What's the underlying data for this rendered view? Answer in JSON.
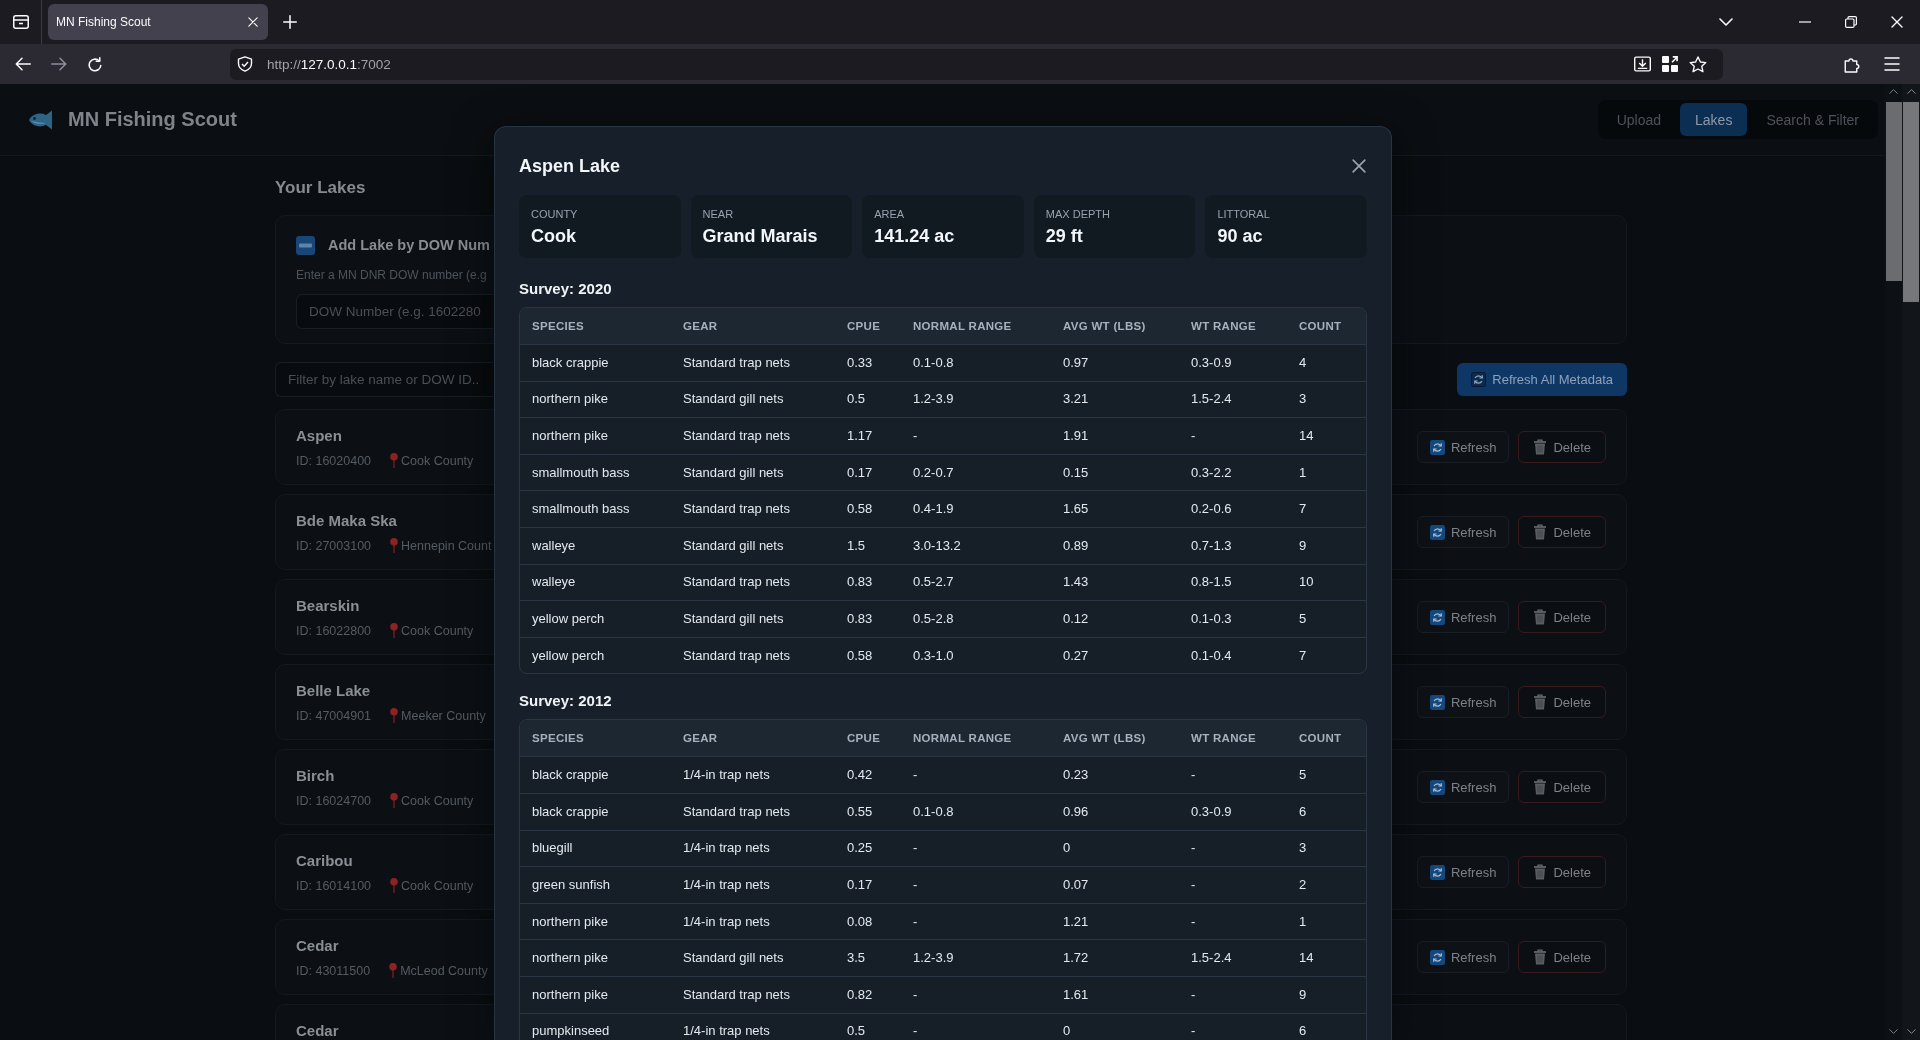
{
  "browser": {
    "tab_title": "MN Fishing Scout",
    "url": {
      "scheme": "http://",
      "host": "127.0.0.1",
      "port": ":7002"
    }
  },
  "app": {
    "title": "MN Fishing Scout",
    "nav": [
      {
        "label": "Upload",
        "selected": false
      },
      {
        "label": "Lakes",
        "selected": true
      },
      {
        "label": "Search & Filter",
        "selected": false
      }
    ]
  },
  "lakes": {
    "heading": "Your Lakes",
    "add_lake": {
      "title": "Add Lake by DOW Num",
      "hint": "Enter a MN DNR DOW number (e.g",
      "dow_field": {
        "placeholder": "DOW Number (e.g. 1602280"
      }
    },
    "filter_field": {
      "placeholder": "Filter by lake name or DOW ID.."
    },
    "refresh_all_button": "Refresh All Metadata",
    "items": [
      {
        "name": "Aspen",
        "id": "ID: 16020400",
        "county": "Cook County",
        "refresh": "Refresh",
        "delete": "Delete"
      },
      {
        "name": "Bde Maka Ska",
        "id": "ID: 27003100",
        "county": "Hennepin Count",
        "refresh": "Refresh",
        "delete": "Delete"
      },
      {
        "name": "Bearskin",
        "id": "ID: 16022800",
        "county": "Cook County",
        "refresh": "Refresh",
        "delete": "Delete"
      },
      {
        "name": "Belle Lake",
        "id": "ID: 47004901",
        "county": "Meeker County",
        "refresh": "Refresh",
        "delete": "Delete"
      },
      {
        "name": "Birch",
        "id": "ID: 16024700",
        "county": "Cook County",
        "refresh": "Refresh",
        "delete": "Delete"
      },
      {
        "name": "Caribou",
        "id": "ID: 16014100",
        "county": "Cook County",
        "refresh": "Refresh",
        "delete": "Delete"
      },
      {
        "name": "Cedar",
        "id": "ID: 43011500",
        "county": "McLeod County",
        "refresh": "Refresh",
        "delete": "Delete"
      },
      {
        "name": "Cedar"
      }
    ]
  },
  "dialog": {
    "title": "Aspen Lake",
    "stats": [
      {
        "label": "COUNTY",
        "value": "Cook"
      },
      {
        "label": "NEAR",
        "value": "Grand Marais"
      },
      {
        "label": "AREA",
        "value": "141.24 ac"
      },
      {
        "label": "MAX DEPTH",
        "value": "29 ft"
      },
      {
        "label": "LITTORAL",
        "value": "90 ac"
      }
    ],
    "surveys": [
      {
        "title": "Survey: 2020",
        "columns": [
          "SPECIES",
          "GEAR",
          "CPUE",
          "NORMAL RANGE",
          "AVG WT (LBS)",
          "WT RANGE",
          "COUNT"
        ],
        "rows": [
          [
            "black crappie",
            "Standard trap nets",
            "0.33",
            "0.1-0.8",
            "0.97",
            "0.3-0.9",
            "4"
          ],
          [
            "northern pike",
            "Standard gill nets",
            "0.5",
            "1.2-3.9",
            "3.21",
            "1.5-2.4",
            "3"
          ],
          [
            "northern pike",
            "Standard trap nets",
            "1.17",
            "-",
            "1.91",
            "-",
            "14"
          ],
          [
            "smallmouth bass",
            "Standard gill nets",
            "0.17",
            "0.2-0.7",
            "0.15",
            "0.3-2.2",
            "1"
          ],
          [
            "smallmouth bass",
            "Standard trap nets",
            "0.58",
            "0.4-1.9",
            "1.65",
            "0.2-0.6",
            "7"
          ],
          [
            "walleye",
            "Standard gill nets",
            "1.5",
            "3.0-13.2",
            "0.89",
            "0.7-1.3",
            "9"
          ],
          [
            "walleye",
            "Standard trap nets",
            "0.83",
            "0.5-2.7",
            "1.43",
            "0.8-1.5",
            "10"
          ],
          [
            "yellow perch",
            "Standard gill nets",
            "0.83",
            "0.5-2.8",
            "0.12",
            "0.1-0.3",
            "5"
          ],
          [
            "yellow perch",
            "Standard trap nets",
            "0.58",
            "0.3-1.0",
            "0.27",
            "0.1-0.4",
            "7"
          ]
        ]
      },
      {
        "title": "Survey: 2012",
        "columns": [
          "SPECIES",
          "GEAR",
          "CPUE",
          "NORMAL RANGE",
          "AVG WT (LBS)",
          "WT RANGE",
          "COUNT"
        ],
        "rows": [
          [
            "black crappie",
            "1/4-in trap nets",
            "0.42",
            "-",
            "0.23",
            "-",
            "5"
          ],
          [
            "black crappie",
            "Standard trap nets",
            "0.55",
            "0.1-0.8",
            "0.96",
            "0.3-0.9",
            "6"
          ],
          [
            "bluegill",
            "1/4-in trap nets",
            "0.25",
            "-",
            "0",
            "-",
            "3"
          ],
          [
            "green sunfish",
            "1/4-in trap nets",
            "0.17",
            "-",
            "0.07",
            "-",
            "2"
          ],
          [
            "northern pike",
            "1/4-in trap nets",
            "0.08",
            "-",
            "1.21",
            "-",
            "1"
          ],
          [
            "northern pike",
            "Standard gill nets",
            "3.5",
            "1.2-3.9",
            "1.72",
            "1.5-2.4",
            "14"
          ],
          [
            "northern pike",
            "Standard trap nets",
            "0.82",
            "-",
            "1.61",
            "-",
            "9"
          ],
          [
            "pumpkinseed",
            "1/4-in trap nets",
            "0.5",
            "-",
            "0",
            "-",
            "6"
          ]
        ]
      }
    ]
  }
}
